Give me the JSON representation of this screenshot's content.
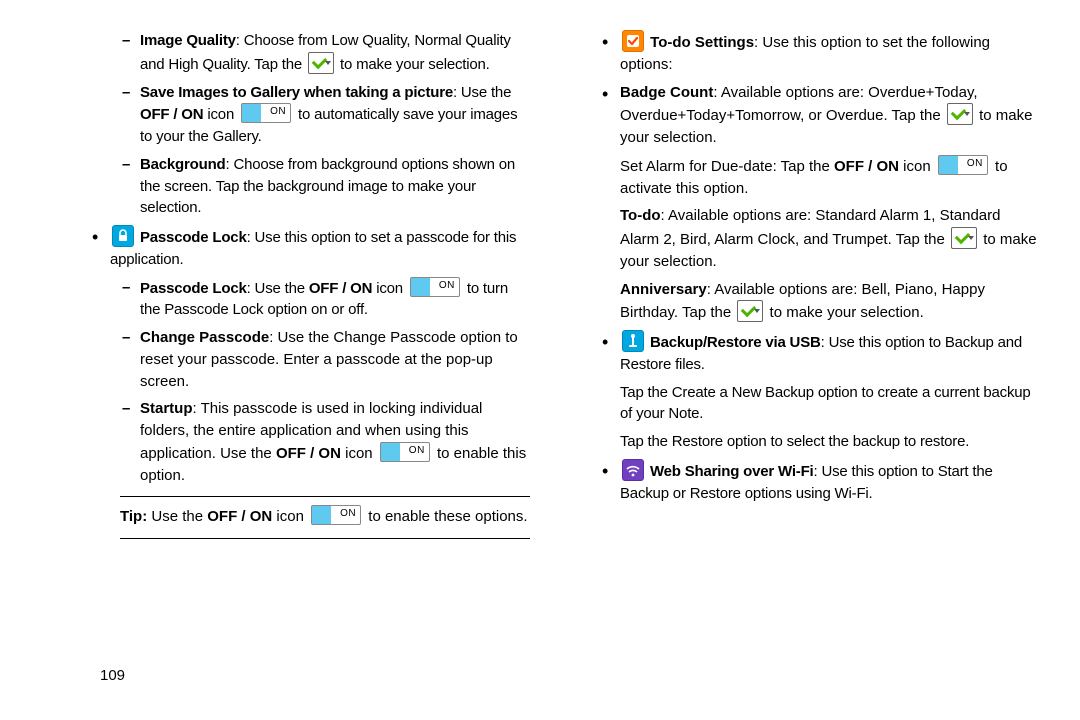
{
  "page_number": "109",
  "on_label": "ON",
  "left_col": {
    "image_quality": {
      "title": "Image Quality",
      "text1": ":  Choose from Low Quality, Normal Quality and High Quality.",
      "text2": " Tap the ",
      "text3": " to make your selection."
    },
    "save_images": {
      "title": "Save Images to Gallery when taking a picture",
      "text1": ": Use the ",
      "off_on": "OFF / ON",
      "text2": " icon ",
      "text3": " to automatically save your images to your the Gallery."
    },
    "background": {
      "title": "Background",
      "text": ": Choose from background options shown on the screen. Tap the background image to make your selection."
    },
    "passcode_lock_intro": {
      "title": "Passcode Lock",
      "text": ": Use this option to set a passcode for this application."
    },
    "passcode_lock": {
      "title": "Passcode Lock",
      "text1": ": Use the ",
      "off_on": "OFF / ON",
      "text2": " icon  ",
      "text3": "  to turn the Passcode Lock option on or off."
    },
    "change_passcode": {
      "title": "Change Passcode",
      "text": ": Use the Change Passcode option to reset your passcode. Enter a passcode at the pop-up screen."
    },
    "startup": {
      "title": "Startup",
      "text1": ": This passcode is used in locking individual folders, the entire application and when using this application. ",
      "text2": "Use the ",
      "off_on": "OFF / ON",
      "text3": " icon ",
      "text4": " to enable this option."
    },
    "tip": {
      "label": "Tip:",
      "text1": " Use the ",
      "off_on": "OFF / ON",
      "text2": " icon ",
      "text3": " to enable these options."
    }
  },
  "right_col": {
    "todo_settings": {
      "title": "To-do Settings",
      "text": ": Use this option to set the following options:"
    },
    "badge_count": {
      "title": "Badge Count",
      "text1": ": Available options are: Overdue+Today, Overdue+Today+Tomorrow, or Overdue.",
      "text2": " Tap the ",
      "text3": " to make your selection."
    },
    "set_alarm": {
      "text1": "Set Alarm for Due-date: Tap the ",
      "off_on": "OFF / ON",
      "text2": " icon ",
      "text3": " to activate this option."
    },
    "todo": {
      "title": "To-do",
      "text1": ": Available options are: Standard Alarm 1, Standard Alarm 2, Bird, Alarm Clock, and Trumpet.",
      "text2": " Tap the ",
      "text3": " to make your selection."
    },
    "anniversary": {
      "title": "Anniversary",
      "text1": ": Available options are: Bell, Piano, Happy Birthday.",
      "text2": " Tap the ",
      "text3": " to make your selection."
    },
    "backup": {
      "title": "Backup/Restore via USB",
      "text": ": Use this option to Backup and Restore files."
    },
    "backup_p2": "Tap the Create a New Backup option to create a current backup of your Note.",
    "backup_p3": "Tap the Restore option to select the backup to restore.",
    "websharing": {
      "title": "Web Sharing over Wi-Fi",
      "text": ": Use this option to Start the Backup or Restore options using Wi-Fi."
    }
  }
}
